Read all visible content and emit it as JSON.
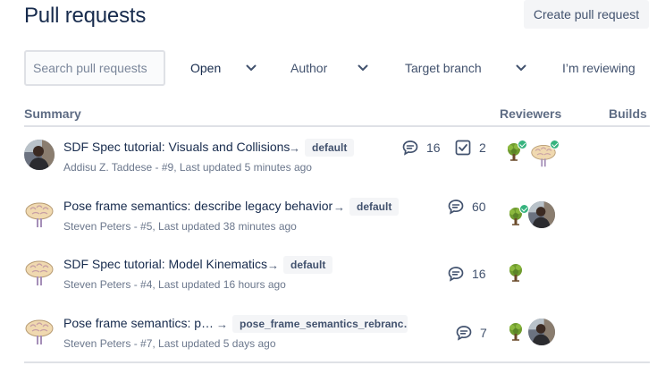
{
  "page": {
    "title": "Pull requests",
    "create_button": "Create pull request"
  },
  "filters": {
    "search_placeholder": "Search pull requests",
    "state": "Open",
    "author": "Author",
    "target_branch": "Target branch",
    "reviewing": "I’m reviewing"
  },
  "table": {
    "headers": {
      "summary": "Summary",
      "reviewers": "Reviewers",
      "builds": "Builds"
    }
  },
  "pull_requests": [
    {
      "title": "SDF Spec tutorial: Visuals and Collisions",
      "branch": "default",
      "meta": "Addisu Z. Taddese - #9, Last updated 5 minutes ago",
      "author_avatar": "photo-avatar",
      "comments": "16",
      "tasks": "2",
      "reviewers": [
        {
          "avatar": "tree-avatar",
          "approved": true
        },
        {
          "avatar": "brain-avatar",
          "approved": true
        }
      ]
    },
    {
      "title": "Pose frame semantics: describe legacy behavior",
      "branch": "default",
      "meta": "Steven Peters - #5, Last updated 38 minutes ago",
      "author_avatar": "brain-avatar",
      "comments": "60",
      "tasks": "",
      "reviewers": [
        {
          "avatar": "tree-avatar",
          "approved": true
        },
        {
          "avatar": "photo-avatar",
          "approved": false
        }
      ]
    },
    {
      "title": "SDF Spec tutorial: Model Kinematics",
      "branch": "default",
      "meta": "Steven Peters - #4, Last updated 16 hours ago",
      "author_avatar": "brain-avatar",
      "comments": "16",
      "tasks": "",
      "reviewers": [
        {
          "avatar": "tree-avatar",
          "approved": false
        }
      ]
    },
    {
      "title": "Pose frame semantics: p…",
      "branch": "pose_frame_semantics_rebranc…",
      "meta": "Steven Peters - #7, Last updated 5 days ago",
      "author_avatar": "brain-avatar",
      "comments": "7",
      "tasks": "",
      "reviewers": [
        {
          "avatar": "tree-avatar",
          "approved": false
        },
        {
          "avatar": "photo-avatar",
          "approved": false
        }
      ]
    }
  ],
  "colors": {
    "text": "#172b4d",
    "subtle": "#6b778c",
    "border": "#dfe1e6",
    "approved": "#36b37e",
    "button_bg": "#f4f5f7"
  }
}
